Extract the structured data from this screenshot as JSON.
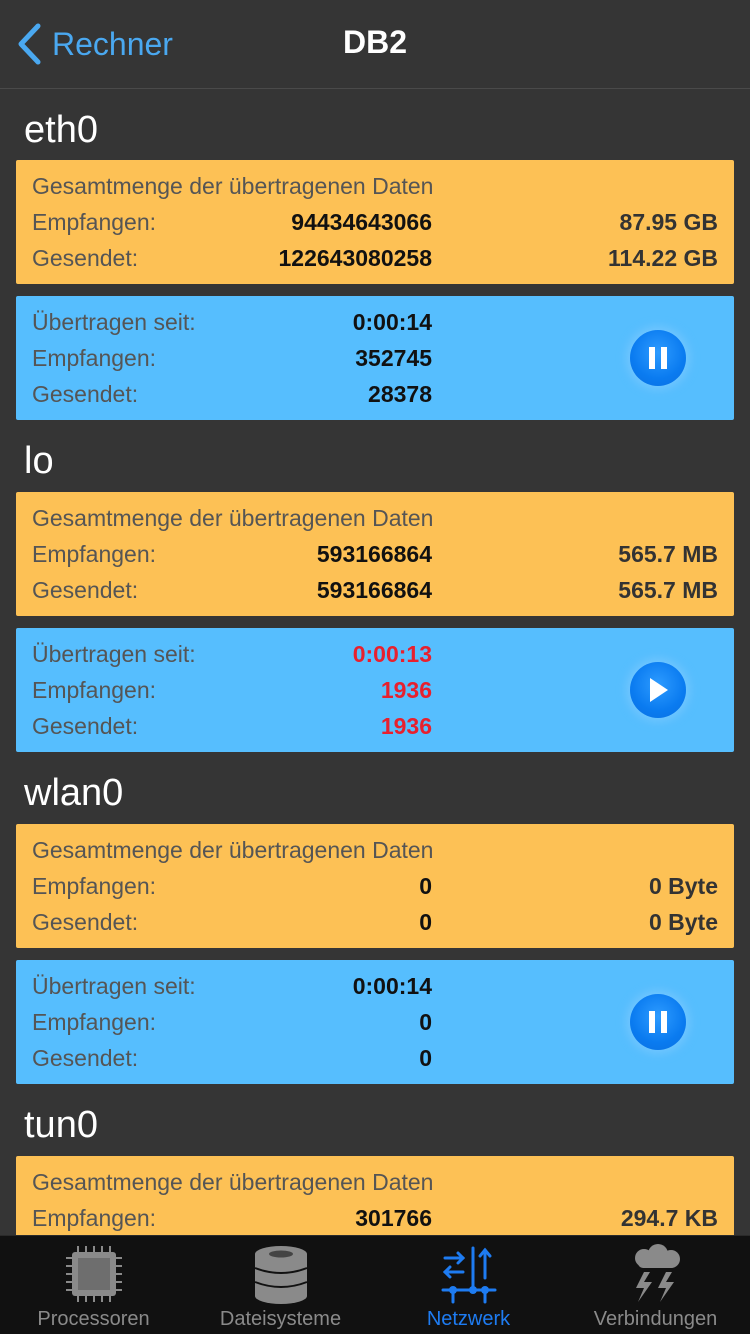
{
  "nav": {
    "back_label": "Rechner",
    "title": "DB2"
  },
  "sections": [
    {
      "name": "eth0",
      "total": {
        "heading": "Gesamtmenge der übertragenen Daten",
        "received_label": "Empfangen:",
        "received_value": "94434643066",
        "received_human": "87.95 GB",
        "sent_label": "Gesendet:",
        "sent_value": "122643080258",
        "sent_human": "114.22 GB"
      },
      "live": {
        "since_label": "Übertragen seit:",
        "since_value": "0:00:14",
        "received_label": "Empfangen:",
        "received_value": "352745",
        "sent_label": "Gesendet:",
        "sent_value": "28378",
        "state": "pause-icon"
      }
    },
    {
      "name": "lo",
      "total": {
        "heading": "Gesamtmenge der übertragenen Daten",
        "received_label": "Empfangen:",
        "received_value": "593166864",
        "received_human": "565.7 MB",
        "sent_label": "Gesendet:",
        "sent_value": "593166864",
        "sent_human": "565.7 MB"
      },
      "live": {
        "since_label": "Übertragen seit:",
        "since_value": "0:00:13",
        "received_label": "Empfangen:",
        "received_value": "1936",
        "sent_label": "Gesendet:",
        "sent_value": "1936",
        "state": "play-icon"
      }
    },
    {
      "name": "wlan0",
      "total": {
        "heading": "Gesamtmenge der übertragenen Daten",
        "received_label": "Empfangen:",
        "received_value": "0",
        "received_human": "0 Byte",
        "sent_label": "Gesendet:",
        "sent_value": "0",
        "sent_human": "0 Byte"
      },
      "live": {
        "since_label": "Übertragen seit:",
        "since_value": "0:00:14",
        "received_label": "Empfangen:",
        "received_value": "0",
        "sent_label": "Gesendet:",
        "sent_value": "0",
        "state": "pause-icon"
      }
    },
    {
      "name": "tun0",
      "total": {
        "heading": "Gesamtmenge der übertragenen Daten",
        "received_label": "Empfangen:",
        "received_value": "301766",
        "received_human": "294.7 KB"
      }
    }
  ],
  "tabs": [
    {
      "label": "Processoren",
      "icon": "cpu-chip-icon"
    },
    {
      "label": "Dateisysteme",
      "icon": "database-icon"
    },
    {
      "label": "Netzwerk",
      "icon": "network-icon",
      "active": true
    },
    {
      "label": "Verbindungen",
      "icon": "storm-cloud-icon"
    }
  ],
  "colors": {
    "accent": "#1e7cf2",
    "total_card": "#fdc155",
    "live_card": "#56befe",
    "alert": "#e8202e",
    "background": "#353535"
  }
}
